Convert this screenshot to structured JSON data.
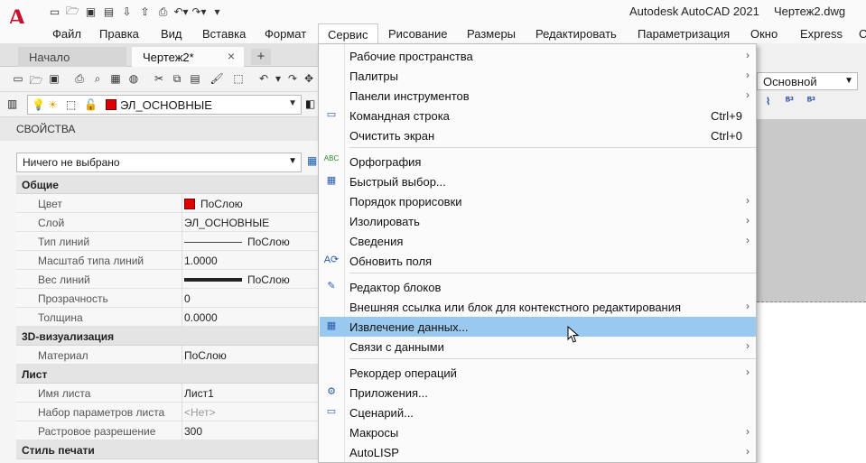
{
  "title": {
    "app": "Autodesk AutoCAD 2021",
    "document": "Чертеж2.dwg",
    "logo_letter": "A"
  },
  "menubar": {
    "items": [
      "Файл",
      "Правка",
      "Вид",
      "Вставка",
      "Формат",
      "Сервис",
      "Рисование",
      "Размеры",
      "Редактировать",
      "Параметризация",
      "Окно",
      "Express"
    ],
    "active": "Сервис",
    "trailing": "С"
  },
  "tabs": {
    "home": "Начало",
    "current": "Чертеж2*",
    "close": "×",
    "add": "+"
  },
  "layer": {
    "name": "ЭЛ_ОСНОВНЫЕ",
    "color": "#e00000"
  },
  "text_style": {
    "value": "Основной"
  },
  "properties": {
    "title": "СВОЙСТВА",
    "selection": "Ничего не выбрано",
    "categories": {
      "general": "Общие",
      "viz3d": "3D-визуализация",
      "sheet": "Лист",
      "plotstyle": "Стиль печати"
    },
    "rows": {
      "color": {
        "k": "Цвет",
        "v": "ПоСлою"
      },
      "layer": {
        "k": "Слой",
        "v": "ЭЛ_ОСНОВНЫЕ"
      },
      "linetype": {
        "k": "Тип линий",
        "v": "ПоСлою"
      },
      "ltscale": {
        "k": "Масштаб типа линий",
        "v": "1.0000"
      },
      "lineweight": {
        "k": "Вес линий",
        "v": "ПоСлою"
      },
      "transparency": {
        "k": "Прозрачность",
        "v": "0"
      },
      "thickness": {
        "k": "Толщина",
        "v": "0.0000"
      },
      "material": {
        "k": "Материал",
        "v": "ПоСлою"
      },
      "sheetname": {
        "k": "Имя листа",
        "v": "Лист1"
      },
      "pagesetup": {
        "k": "Набор параметров листа",
        "v": "<Нет>"
      },
      "raster": {
        "k": "Растровое разрешение",
        "v": "300"
      }
    }
  },
  "dropdown": {
    "items": [
      {
        "label": "Рабочие пространства",
        "arrow": "›"
      },
      {
        "label": "Палитры",
        "arrow": "›"
      },
      {
        "label": "Панели инструментов",
        "arrow": "›"
      },
      {
        "label": "Командная строка",
        "shortcut": "Ctrl+9"
      },
      {
        "label": "Очистить экран",
        "shortcut": "Ctrl+0"
      },
      {
        "label": "Орфография"
      },
      {
        "label": "Быстрый выбор..."
      },
      {
        "label": "Порядок прорисовки",
        "arrow": "›"
      },
      {
        "label": "Изолировать",
        "arrow": "›"
      },
      {
        "label": "Сведения",
        "arrow": "›"
      },
      {
        "label": "Обновить поля"
      },
      {
        "label": "Редактор блоков"
      },
      {
        "label": "Внешняя ссылка или блок для контекстного редактирования",
        "arrow": "›"
      },
      {
        "label": "Извлечение данных..."
      },
      {
        "label": "Связи с данными",
        "arrow": "›"
      },
      {
        "label": "Рекордер операций",
        "arrow": "›"
      },
      {
        "label": "Приложения..."
      },
      {
        "label": "Сценарий..."
      },
      {
        "label": "Макросы",
        "arrow": "›"
      },
      {
        "label": "AutoLISP",
        "arrow": "›"
      }
    ],
    "highlighted": "Извлечение данных..."
  },
  "colors": {
    "menu_highlight": "#99c9ef",
    "bylayer_red": "#e00000",
    "logo_red": "#c8102e"
  },
  "icons": {
    "qat": [
      "new-icon",
      "open-icon",
      "save-icon",
      "save-as-icon",
      "open-from-web-icon",
      "save-to-web-icon",
      "plot-icon",
      "undo-icon",
      "redo-icon",
      "customize-icon"
    ],
    "abc_label": "ABC"
  }
}
